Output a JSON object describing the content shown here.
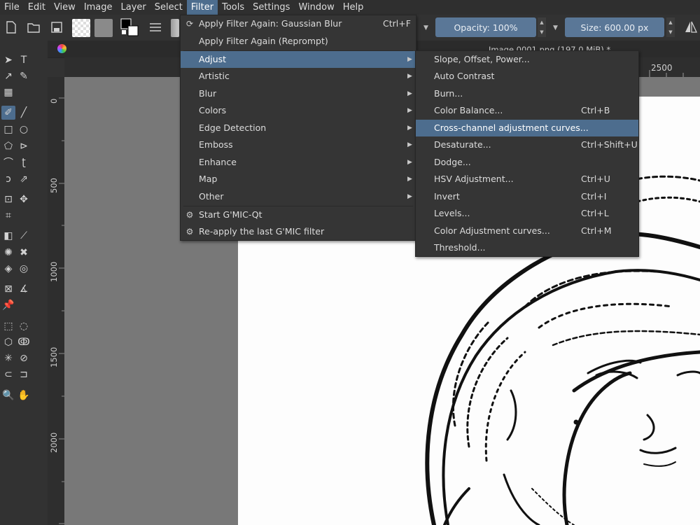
{
  "menubar": {
    "items": [
      "File",
      "Edit",
      "View",
      "Image",
      "Layer",
      "Select",
      "Filter",
      "Tools",
      "Settings",
      "Window",
      "Help"
    ],
    "active": "Filter"
  },
  "toolbar": {
    "opacity": "Opacity: 100%",
    "size": "Size: 600.00 px"
  },
  "document": {
    "tab_title": "Image 0001.png (197.0 MiB) *"
  },
  "ruler": {
    "h_label": "2500",
    "v_labels": [
      "0",
      "500",
      "1000",
      "1500",
      "2000"
    ]
  },
  "filter_menu": {
    "apply_again": "Apply Filter Again: Gaussian Blur",
    "apply_again_shortcut": "Ctrl+F",
    "apply_again_reprompt": "Apply Filter Again (Reprompt)",
    "categories": [
      "Adjust",
      "Artistic",
      "Blur",
      "Colors",
      "Edge Detection",
      "Emboss",
      "Enhance",
      "Map",
      "Other"
    ],
    "gmic": [
      "Start G'MIC-Qt",
      "Re-apply the last G'MIC filter"
    ]
  },
  "adjust_menu": [
    {
      "label": "Slope, Offset, Power...",
      "shortcut": ""
    },
    {
      "label": "Auto Contrast",
      "shortcut": ""
    },
    {
      "label": "Burn...",
      "shortcut": ""
    },
    {
      "label": "Color Balance...",
      "shortcut": "Ctrl+B"
    },
    {
      "label": "Cross-channel adjustment curves...",
      "shortcut": ""
    },
    {
      "label": "Desaturate...",
      "shortcut": "Ctrl+Shift+U"
    },
    {
      "label": "Dodge...",
      "shortcut": ""
    },
    {
      "label": "HSV Adjustment...",
      "shortcut": "Ctrl+U"
    },
    {
      "label": "Invert",
      "shortcut": "Ctrl+I"
    },
    {
      "label": "Levels...",
      "shortcut": "Ctrl+L"
    },
    {
      "label": "Color Adjustment curves...",
      "shortcut": "Ctrl+M"
    },
    {
      "label": "Threshold...",
      "shortcut": ""
    }
  ],
  "colors": {
    "highlight": "#4d6d8e",
    "menu_bg": "#353535",
    "canvas": "#787878"
  }
}
